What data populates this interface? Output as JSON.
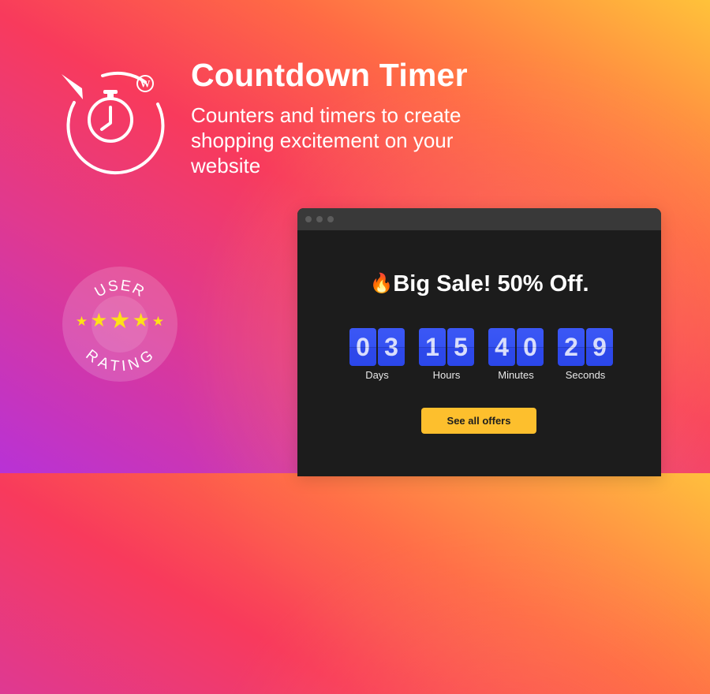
{
  "hero": {
    "title": "Countdown Timer",
    "subtitle": "Counters and timers to create shopping excitement on your website"
  },
  "icons": {
    "logo": "stopwatch-icon",
    "platform": "wordpress-icon"
  },
  "badge": {
    "top_text": "USER",
    "bottom_text": "RATING",
    "stars": "★",
    "star_count": 5
  },
  "preview": {
    "headline_emoji": "🔥",
    "headline": "Big Sale! 50% Off.",
    "units": [
      {
        "label": "Days",
        "digits": [
          "0",
          "3"
        ]
      },
      {
        "label": "Hours",
        "digits": [
          "1",
          "5"
        ]
      },
      {
        "label": "Minutes",
        "digits": [
          "4",
          "0"
        ]
      },
      {
        "label": "Seconds",
        "digits": [
          "2",
          "9"
        ]
      }
    ],
    "cta_label": "See all offers"
  },
  "colors": {
    "digit_blue": "#3552f2",
    "cta_yellow": "#fdbf2d",
    "star_yellow": "#ffe116",
    "window_bg": "#1c1c1c"
  }
}
